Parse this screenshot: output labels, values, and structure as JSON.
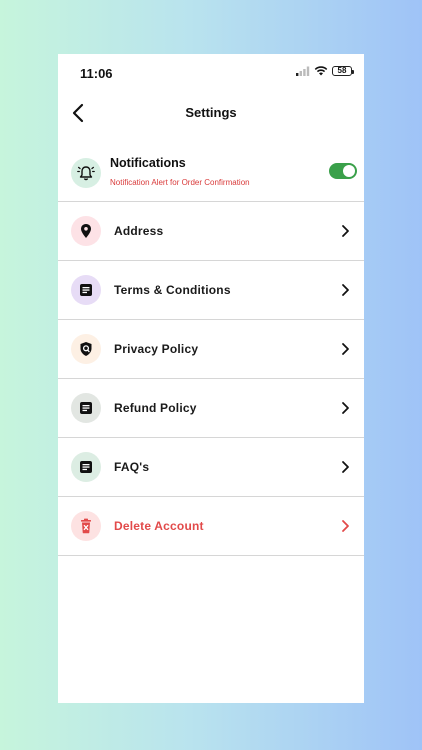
{
  "status_bar": {
    "time": "11:06",
    "battery": "58"
  },
  "header": {
    "title": "Settings"
  },
  "notifications": {
    "title": "Notifications",
    "subtitle": "Notification Alert for Order Confirmation",
    "enabled": true,
    "icon": "bell-ring-icon"
  },
  "items": [
    {
      "label": "Address",
      "icon": "location-pin-icon",
      "bg": "#fde2e6",
      "color": "#111111"
    },
    {
      "label": "Terms & Conditions",
      "icon": "document-icon",
      "bg": "#e7dcf6",
      "color": "#111111"
    },
    {
      "label": "Privacy Policy",
      "icon": "shield-icon",
      "bg": "#fdf0e4",
      "color": "#111111"
    },
    {
      "label": "Refund Policy",
      "icon": "document-icon",
      "bg": "#e2e6e2",
      "color": "#111111"
    },
    {
      "label": "FAQ's",
      "icon": "document-icon",
      "bg": "#dcede3",
      "color": "#111111"
    },
    {
      "label": "Delete Account",
      "icon": "trash-icon",
      "bg": "#fde2e2",
      "color": "#e24a4a"
    }
  ],
  "colors": {
    "toggle_on": "#3aa04a",
    "danger": "#e24a4a",
    "divider": "#d6d6d6"
  }
}
